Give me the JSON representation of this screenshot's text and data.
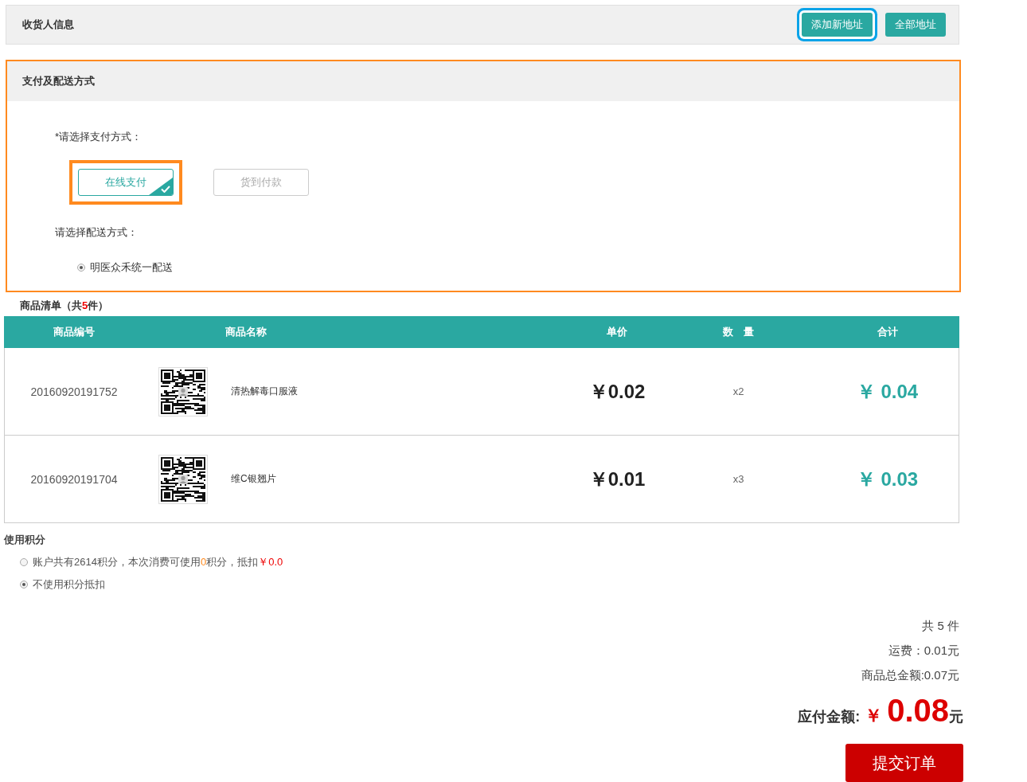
{
  "consignee": {
    "title": "收货人信息",
    "buttons": [
      {
        "label": "添加新地址",
        "highlighted": true
      },
      {
        "label": "全部地址",
        "highlighted": false
      }
    ]
  },
  "payment_section": {
    "title": "支付及配送方式",
    "highlighted": true,
    "payment_label": "*请选择支付方式：",
    "payment_options": [
      {
        "label": "在线支付",
        "selected": true,
        "highlighted": true
      },
      {
        "label": "货到付款",
        "selected": false,
        "highlighted": false
      }
    ],
    "delivery_label": "请选择配送方式：",
    "delivery_options": [
      {
        "label": "明医众禾统一配送",
        "selected": true
      }
    ]
  },
  "goods": {
    "title_before": "商品清单（共",
    "count": "5",
    "title_after": "件）",
    "columns": [
      "商品编号",
      "商品名称",
      "单价",
      "数　量",
      "合计"
    ],
    "rows": [
      {
        "code": "20160920191752",
        "name": "清热解毒口服液",
        "unit_price": "￥0.02",
        "quantity": "x2",
        "subtotal": "￥ 0.04"
      },
      {
        "code": "20160920191704",
        "name": "维C银翘片",
        "unit_price": "￥0.01",
        "quantity": "x3",
        "subtotal": "￥ 0.03"
      }
    ]
  },
  "points": {
    "title": "使用积分",
    "options": [
      {
        "kind": "points",
        "text_before": "账户共有2614积分，本次消费可使用",
        "usable": "0",
        "text_middle": "积分，抵扣",
        "deduction": "￥0.0",
        "selected": false
      },
      {
        "kind": "plain",
        "label": "不使用积分抵扣",
        "selected": true
      }
    ]
  },
  "summary": {
    "count": "共 5 件",
    "shipping": "运费：0.01元",
    "goods_total": "商品总金额:0.07元",
    "payable_label": "应付金额:",
    "payable_currency": "￥",
    "payable_amount": "0.08",
    "payable_unit": "元",
    "submit": "提交订单"
  }
}
